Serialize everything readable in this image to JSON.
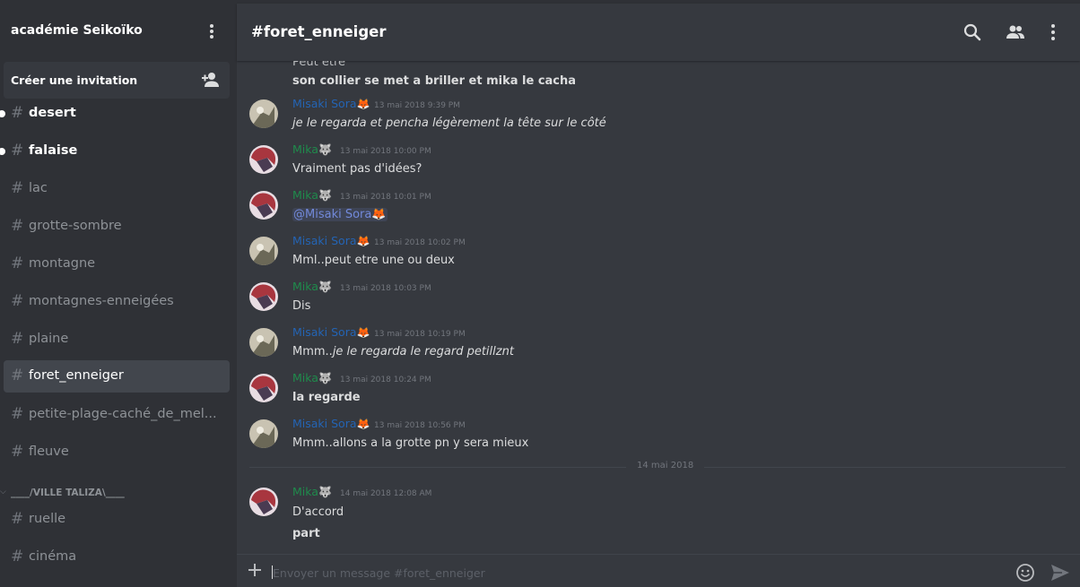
{
  "server": {
    "name": "académie Seikoïko"
  },
  "invite": {
    "label": "Créer une invitation"
  },
  "channels": [
    {
      "name": "desert"
    },
    {
      "name": "falaise"
    },
    {
      "name": "lac"
    },
    {
      "name": "grotte-sombre"
    },
    {
      "name": "montagne"
    },
    {
      "name": "montagnes-enneigées"
    },
    {
      "name": "plaine"
    },
    {
      "name": "foret_enneiger"
    },
    {
      "name": "petite-plage-caché_de_mel..."
    },
    {
      "name": "fleuve"
    }
  ],
  "category": {
    "label": "____/VILLE TALIZA\\____"
  },
  "channels2": [
    {
      "name": "ruelle"
    },
    {
      "name": "cinéma"
    }
  ],
  "hash_symbol": "#",
  "header": {
    "title": "#foret_enneiger"
  },
  "colors": {
    "misaki": "#2464b4",
    "mika": "#1f8b4c",
    "active_channel": "#42464d",
    "mention": "#7289da"
  },
  "icons": {
    "search": "search-icon",
    "members": "members-icon",
    "more": "more-vertical-icon",
    "invite": "add-person-icon",
    "emoji": "smiley-icon",
    "send": "send-icon",
    "plus": "plus-icon"
  },
  "messages": {
    "top": {
      "line1": "Peut etre",
      "line2": "son collier se met a briller et mika le cacha"
    },
    "m1": {
      "author": "Misaki Sora",
      "emoji": "🦊",
      "time": "13 mai 2018 9:39 PM",
      "text": "je le regarda et pencha légèrement la tête sur le côté"
    },
    "m2": {
      "author": "Mika",
      "emoji": "🐺",
      "time": "13 mai 2018 10:00 PM",
      "text": "Vraiment pas d'idées?"
    },
    "m3": {
      "author": "Mika",
      "emoji": "🐺",
      "time": "13 mai 2018 10:01 PM",
      "text": "@Misaki Sora🦊"
    },
    "m4": {
      "author": "Misaki Sora",
      "emoji": "🦊",
      "time": "13 mai 2018 10:02 PM",
      "text": "Mml..peut etre une ou deux"
    },
    "m5": {
      "author": "Mika",
      "emoji": "🐺",
      "time": "13 mai 2018 10:03 PM",
      "text": "Dis"
    },
    "m6": {
      "author": "Misaki Sora",
      "emoji": "🦊",
      "time": "13 mai 2018 10:19 PM",
      "text_prefix": "Mmm..",
      "text_em": "je le regarda le regard petillznt"
    },
    "m7": {
      "author": "Mika",
      "emoji": "🐺",
      "time": "13 mai 2018 10:24 PM",
      "text": "la regarde"
    },
    "m8": {
      "author": "Misaki Sora",
      "emoji": "🦊",
      "time": "13 mai 2018 10:56 PM",
      "text": "Mmm..allons a la grotte pn y sera mieux"
    },
    "m9": {
      "author": "Mika",
      "emoji": "🐺",
      "time": "14 mai 2018 12:08 AM",
      "text1": "D'accord",
      "text2": "part"
    }
  },
  "date_divider": "14 mai 2018",
  "composer": {
    "placeholder": "Envoyer un message #foret_enneiger"
  }
}
